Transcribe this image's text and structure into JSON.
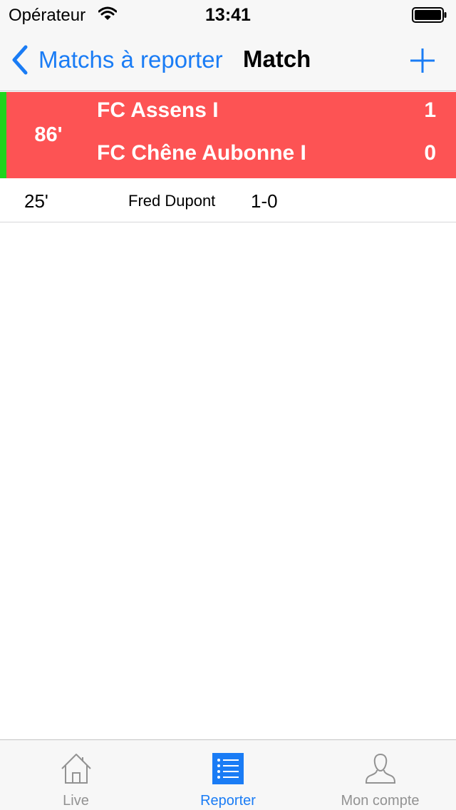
{
  "status_bar": {
    "carrier": "Opérateur",
    "time": "13:41"
  },
  "nav": {
    "back_label": "Matchs à reporter",
    "title": "Match"
  },
  "match": {
    "minute": "86'",
    "home": {
      "name": "FC Assens I",
      "score": "1"
    },
    "away": {
      "name": "FC Chêne Aubonne I",
      "score": "0"
    }
  },
  "events": [
    {
      "minute": "25'",
      "player": "Fred Dupont",
      "score": "1-0"
    }
  ],
  "tabs": [
    {
      "label": "Live",
      "icon": "home-icon",
      "active": false
    },
    {
      "label": "Reporter",
      "icon": "list-icon",
      "active": true
    },
    {
      "label": "Mon compte",
      "icon": "user-icon",
      "active": false
    }
  ],
  "colors": {
    "accent": "#1a7cf5",
    "match_header": "#fd5354",
    "live_indicator": "#20d31d",
    "tab_inactive": "#929292"
  }
}
